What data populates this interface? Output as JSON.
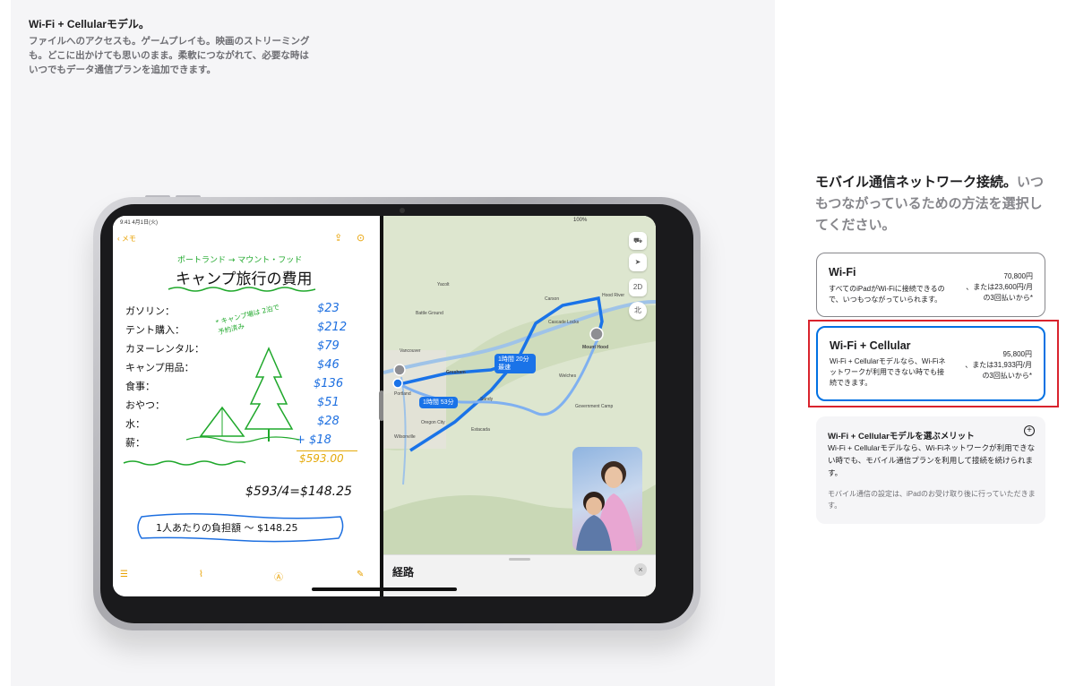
{
  "hero": {
    "title": "Wi-Fi + Cellularモデル。",
    "description": "ファイルへのアクセスも。ゲームプレイも。映画のストリーミングも。どこに出かけても思いのまま。柔軟につながれて、必要な時はいつでもデータ通信プランを追加できます。"
  },
  "ipad_screen": {
    "status_time": "9:41 4月1日(火)",
    "status_right": "100%",
    "notes": {
      "back_label": "メモ",
      "heading_small": "ポートランド → マウント・フッド",
      "heading": "キャンプ旅行の費用",
      "items": [
        "ガソリン：",
        "テント購入：",
        "カヌーレンタル：",
        "キャンプ用品：",
        "食事：",
        "おやつ：",
        "水：",
        "薪："
      ],
      "values": [
        "$23",
        "$212",
        "$79",
        "$46",
        "$136",
        "$51",
        "$28",
        "+ $18"
      ],
      "total": "$593.00",
      "side_note": "* キャンプ場は 2泊で予約済み",
      "division": "$593/4=$148.25",
      "per_person": "1人あたりの負担額 〜 $148.25"
    },
    "maps": {
      "places": [
        "Yacolt",
        "Battle Ground",
        "Vancouver",
        "Portland",
        "Gresham",
        "Sandy",
        "Oregon City",
        "Estacada",
        "Wilsonville",
        "Welches",
        "Mount Hood",
        "Hood River",
        "Cascade Locks",
        "Carson",
        "Government Camp"
      ],
      "route_primary": "1時間 20分 最速",
      "route_alt": "1時間 53分",
      "btn_2d": "2D",
      "btn_north": "北",
      "sheet_title": "経路",
      "close": "×"
    }
  },
  "connection": {
    "heading_dark": "モバイル通信ネットワーク接続。",
    "heading_light": "いつもつながっているための方法を選択してください。",
    "options": [
      {
        "title": "Wi-Fi",
        "description": "すべてのiPadがWi-Fiに接続できるので、いつもつながっていられます。",
        "price": "70,800円",
        "monthly": "、または23,600円/月",
        "installments": "の3回払いから*"
      },
      {
        "title": "Wi-Fi + Cellular",
        "description": "Wi-Fi + Cellularモデルなら、Wi-Fiネットワークが利用できない時でも接続できます。",
        "price": "95,800円",
        "monthly": "、または31,933円/月",
        "installments": "の3回払いから*"
      }
    ],
    "merit": {
      "title": "Wi-Fi + Cellularモデルを選ぶメリット",
      "body": "Wi-Fi + Cellularモデルなら、Wi-Fiネットワークが利用できない時でも、モバイル通信プランを利用して接続を続けられます。",
      "note": "モバイル通信の設定は、iPadのお受け取り後に行っていただきます。"
    }
  },
  "colors": {
    "accent": "#0071e3",
    "highlight": "#d9232d",
    "notes_green": "#1fa82b",
    "notes_blue": "#1d6fe0",
    "notes_yellow": "#e4a90a"
  }
}
